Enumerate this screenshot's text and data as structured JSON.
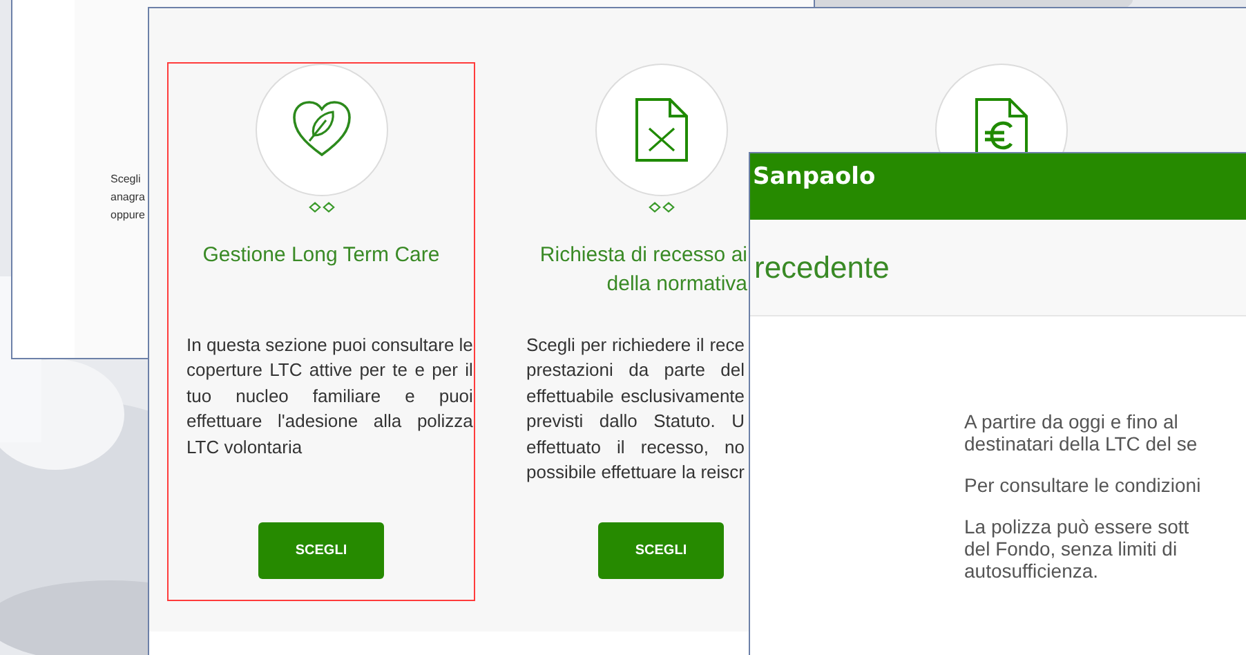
{
  "back_window": {
    "text_lines": [
      "Scegli",
      "anagra",
      "oppure"
    ]
  },
  "main_window": {
    "cards": [
      {
        "kind": "heart-leaf",
        "selected": true,
        "title_lines": [
          "Gestione Long Term Care"
        ],
        "description_lines": [
          "In questa sezione puoi consultare le",
          "coperture LTC attive per te e per il",
          "tuo nucleo familiare e puoi",
          "effettuare l'adesione alla polizza",
          "LTC volontaria"
        ],
        "button": "SCEGLI"
      },
      {
        "kind": "document-x",
        "selected": false,
        "title_lines": [
          "Richiesta di recesso ai",
          "della normativa"
        ],
        "description_lines": [
          "Scegli per richiedere il rece",
          "prestazioni da parte del",
          "effettuabile esclusivamente",
          "previsti dallo Statuto. U",
          "effettuato il recesso, no",
          "possibile effettuare la reiscr"
        ],
        "button": "SCEGLI"
      },
      {
        "kind": "document-euro",
        "selected": false
      }
    ]
  },
  "front_window": {
    "brand": "Sanpaolo",
    "heading": "recedente",
    "paragraphs": [
      [
        "A partire da oggi e fino al",
        "destinatari della LTC del se"
      ],
      [
        "Per consultare le condizioni"
      ],
      [
        "La polizza può essere sott",
        "del Fondo, senza limiti di",
        "autosufficienza."
      ]
    ]
  }
}
